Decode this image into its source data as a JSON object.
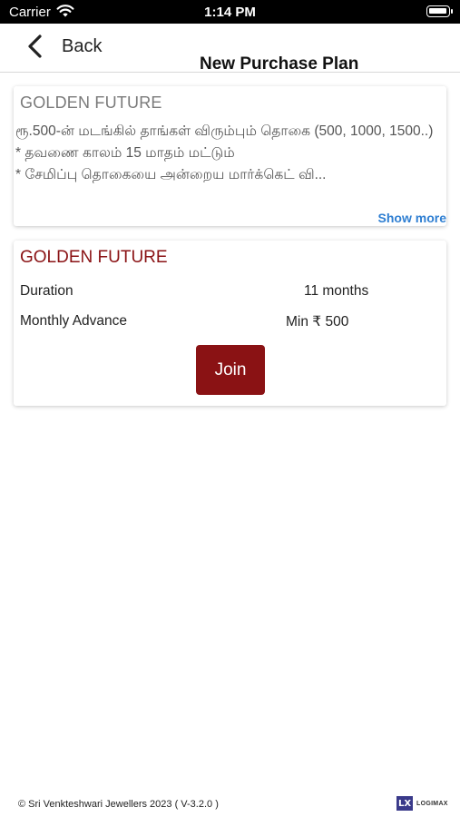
{
  "status_bar": {
    "carrier": "Carrier",
    "time": "1:14 PM"
  },
  "nav": {
    "back_label": "Back",
    "title": "New Purchase Plan"
  },
  "plan_description_card": {
    "title": "GOLDEN FUTURE",
    "lines": [
      "ரூ.500-ன் மடங்கில் தாங்கள் விரும்பும் தொகை (500, 1000, 1500..)",
      "* தவணை காலம் 15 மாதம் மட்டும்",
      "* சேமிப்பு தொகையை அன்றைய மார்க்கெட் வி..."
    ],
    "show_more_label": "Show more"
  },
  "plan_details_card": {
    "title": "GOLDEN FUTURE",
    "rows": [
      {
        "label": "Duration",
        "value": "11 months"
      },
      {
        "label": "Monthly Advance",
        "value": "Min ₹ 500"
      }
    ],
    "join_label": "Join"
  },
  "footer": {
    "copyright": "© Sri Venkteshwari Jewellers 2023 ( V-3.2.0 )",
    "logo_mark": "LX",
    "logo_text": "LOGIMAX"
  },
  "colors": {
    "brand": "#8a1214",
    "link": "#2f7fd2",
    "status_bar_bg": "#000000"
  }
}
